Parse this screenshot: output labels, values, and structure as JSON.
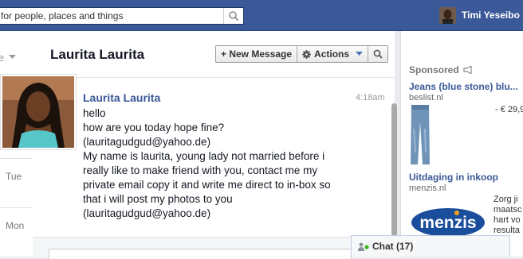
{
  "topbar": {
    "search_placeholder": "for people, places and things",
    "user_name": "Timi Yeseibo"
  },
  "left": {
    "folder_label": "e",
    "days": [
      "Tue",
      "Mon"
    ]
  },
  "thread": {
    "title": "Laurita Laurita",
    "actions": {
      "new_message": "+ New Message",
      "actions": "Actions"
    },
    "message": {
      "sender": "Laurita Laurita",
      "time": "4:18am",
      "lines": [
        "hello",
        "how are you today hope fine?",
        "(lauritagudgud@yahoo.de)",
        "My name is laurita, young lady not married before i",
        "really like to make friend with you, contact me my",
        "private email copy it and write me direct to in-box so",
        "that i will post my photos to you",
        "(lauritagudgud@yahoo.de)"
      ]
    }
  },
  "sidebar": {
    "sponsored_label": "Sponsored",
    "ads": [
      {
        "title": "Jeans (blue stone) blu...",
        "domain": "beslist.nl",
        "price": "- € 29,9"
      },
      {
        "title": "Uitdaging in inkoop",
        "domain": "menzis.nl",
        "logo_text": "menzis",
        "desc": [
          "Zorg ji",
          "maatsc",
          "hart vo",
          "resulta"
        ]
      }
    ]
  },
  "chat": {
    "label": "Chat (17)"
  },
  "colors": {
    "brand": "#3b5998",
    "online": "#42b72a"
  }
}
